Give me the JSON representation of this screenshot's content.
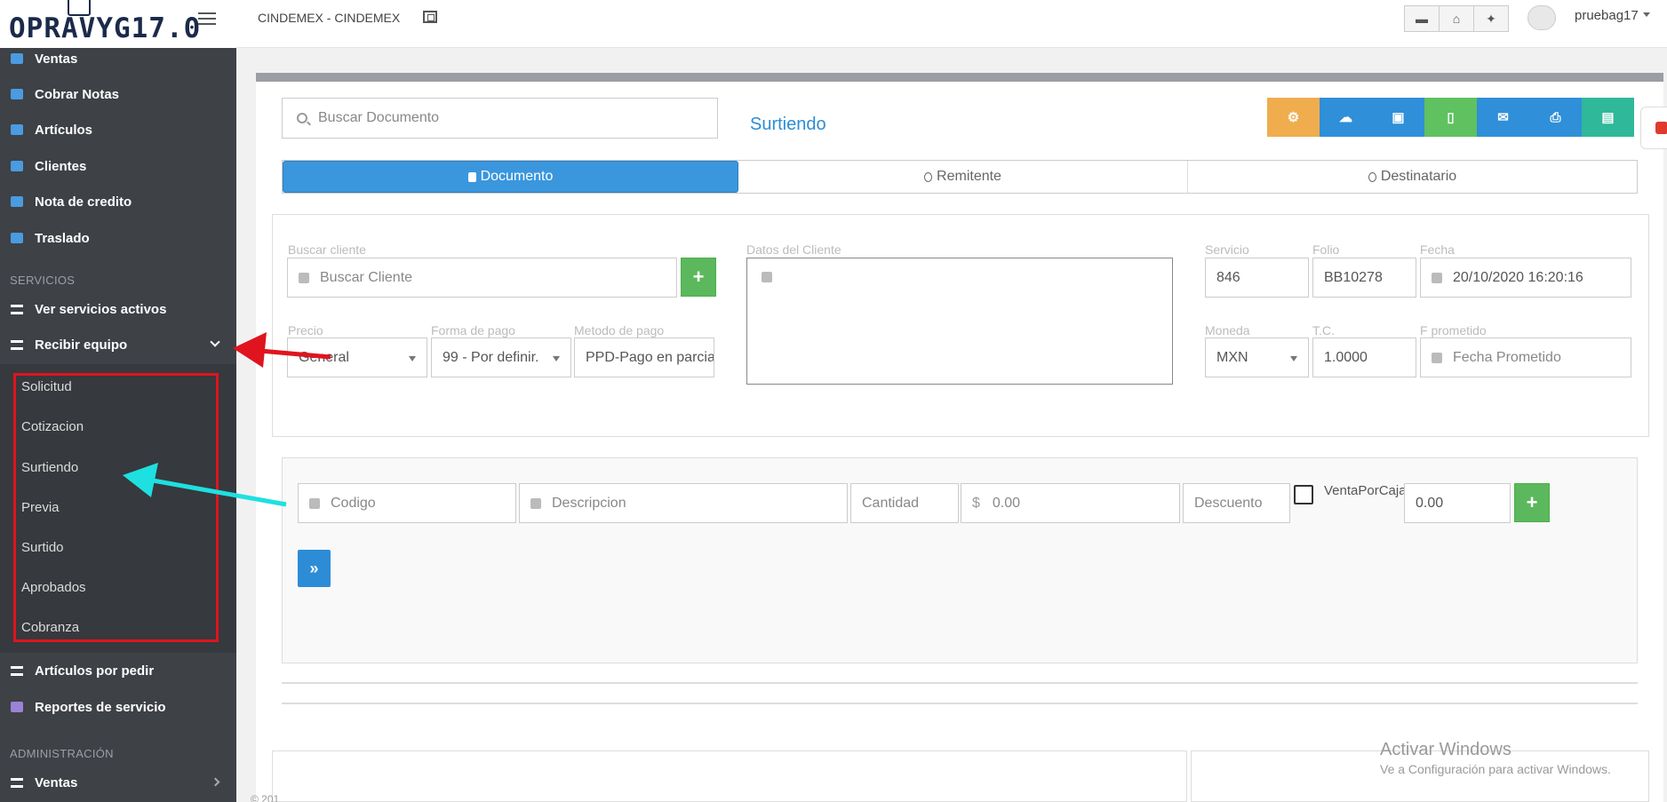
{
  "logo": {
    "text": "OPRAVYG17.0"
  },
  "topbar": {
    "company": "CINDEMEX - CINDEMEX",
    "username": "pruebag17"
  },
  "sidebar": {
    "items_top": [
      {
        "label": "Ventas",
        "icon": "cart-icon"
      },
      {
        "label": "Cobrar Notas",
        "icon": "money-icon"
      },
      {
        "label": "Artículos",
        "icon": "tags-icon"
      },
      {
        "label": "Clientes",
        "icon": "address-book-icon"
      },
      {
        "label": "Nota de credito",
        "icon": "file-icon"
      },
      {
        "label": "Traslado",
        "icon": "file-icon"
      }
    ],
    "section_servicios": "SERVICIOS",
    "items_servicios": [
      {
        "label": "Ver servicios activos",
        "icon": "list-icon"
      },
      {
        "label": "Recibir equipo",
        "icon": "truck-icon"
      }
    ],
    "submenu": [
      "Solicitud",
      "Cotizacion",
      "Surtiendo",
      "Previa",
      "Surtido",
      "Aprobados",
      "Cobranza"
    ],
    "items_after": [
      {
        "label": "Artículos por pedir",
        "icon": "tags-icon"
      },
      {
        "label": "Reportes de servicio",
        "icon": "bar-chart-icon"
      }
    ],
    "section_admin": "ADMINISTRACIÓN",
    "items_admin": [
      {
        "label": "Ventas",
        "icon": "cart-icon"
      }
    ]
  },
  "main": {
    "search_placeholder": "Buscar Documento",
    "page_title": "Surtiendo",
    "tabs": [
      "Documento",
      "Remitente",
      "Destinatario"
    ],
    "form": {
      "buscar_cliente_label": "Buscar cliente",
      "buscar_cliente_placeholder": "Buscar Cliente",
      "datos_cliente_label": "Datos del Cliente",
      "servicio_label": "Servicio",
      "servicio_value": "846",
      "folio_label": "Folio",
      "folio_value": "BB10278",
      "fecha_label": "Fecha",
      "fecha_value": "20/10/2020 16:20:16",
      "precio_label": "Precio",
      "precio_value": "General",
      "forma_pago_label": "Forma de pago",
      "forma_pago_value": "99 - Por definir.",
      "metodo_pago_label": "Metodo de pago",
      "metodo_pago_value": "PPD-Pago en parcia",
      "moneda_label": "Moneda",
      "moneda_value": "MXN",
      "tc_label": "T.C.",
      "tc_value": "1.0000",
      "fprometido_label": "F prometido",
      "fprometido_placeholder": "Fecha Prometido"
    },
    "items": {
      "codigo_placeholder": "Codigo",
      "descripcion_placeholder": "Descripcion",
      "cantidad_placeholder": "Cantidad",
      "currency_symbol": "$",
      "precio_placeholder": "0.00",
      "descuento_placeholder": "Descuento",
      "venta_por_caja_label": "VentaPorCaja",
      "total_value": "0.00"
    },
    "footer": "© 201"
  },
  "watermark": {
    "line1": "Activar Windows",
    "line2": "Ve a Configuración para activar Windows."
  }
}
